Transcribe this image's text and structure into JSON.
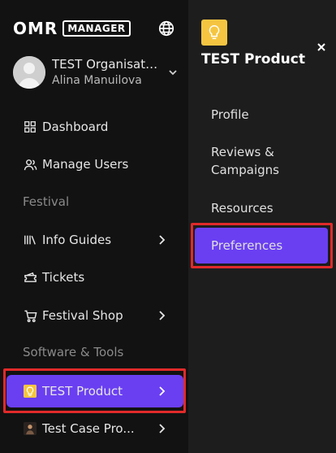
{
  "brand": {
    "logo_text": "OMR",
    "logo_box_text": "MANAGER"
  },
  "org": {
    "name": "TEST Organisati...",
    "user": "Alina Manuilova"
  },
  "sidebar": {
    "items": [
      {
        "label": "Dashboard",
        "icon": "grid-icon"
      },
      {
        "label": "Manage Users",
        "icon": "users-icon"
      },
      {
        "section": "Festival"
      },
      {
        "label": "Info Guides",
        "icon": "books-icon",
        "chevron": true
      },
      {
        "label": "Tickets",
        "icon": "ticket-icon"
      },
      {
        "label": "Festival Shop",
        "icon": "cart-icon",
        "chevron": true
      },
      {
        "section": "Software & Tools"
      },
      {
        "label": "TEST Product",
        "icon": "lightbulb-icon",
        "chevron": true,
        "active": true
      },
      {
        "label": "Test Case Pro...",
        "icon": "product-avatar-icon",
        "chevron": true
      }
    ]
  },
  "panel": {
    "title": "TEST Product",
    "items": [
      {
        "label": "Profile"
      },
      {
        "label": "Reviews & Campaigns"
      },
      {
        "label": "Resources"
      },
      {
        "label": "Preferences",
        "active": true
      }
    ]
  },
  "colors": {
    "accent": "#6a3ff2",
    "highlight": "#e12a2a",
    "product_icon": "#f5c542"
  }
}
